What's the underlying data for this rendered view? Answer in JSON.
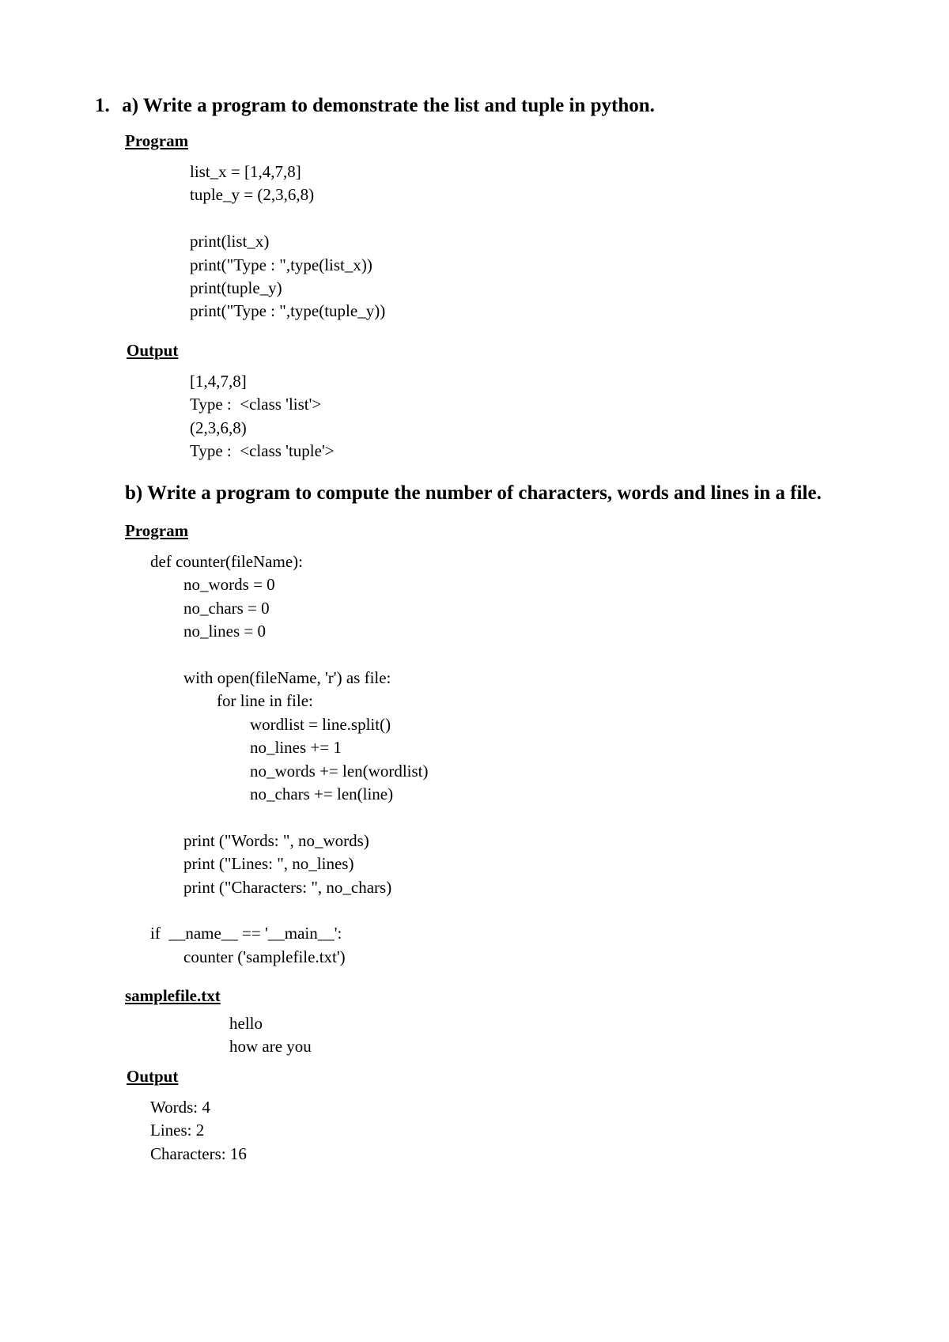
{
  "q1a": {
    "number": "1.",
    "title": "a) Write a program to demonstrate the list and tuple in python.",
    "program_label": "Program",
    "code": "list_x = [1,4,7,8]\ntuple_y = (2,3,6,8)\n\nprint(list_x)\nprint(\"Type : \",type(list_x))\nprint(tuple_y)\nprint(\"Type : \",type(tuple_y))",
    "output_label": "Output",
    "output": "[1,4,7,8]\nType :  <class 'list'>\n(2,3,6,8)\nType :  <class 'tuple'>"
  },
  "q1b": {
    "title": "b) Write a program to compute the number of characters, words and lines in a file.",
    "program_label": "Program",
    "code": "def counter(fileName):\n        no_words = 0\n        no_chars = 0\n        no_lines = 0\n\n        with open(fileName, 'r') as file:\n                for line in file:\n                        wordlist = line.split()\n                        no_lines += 1\n                        no_words += len(wordlist)\n                        no_chars += len(line)\n\n        print (\"Words: \", no_words)\n        print (\"Lines: \", no_lines)\n        print (\"Characters: \", no_chars)\n\nif  __name__ == '__main__':\n        counter ('samplefile.txt')",
    "samplefile_label": "samplefile.txt",
    "samplefile": "hello\nhow are you",
    "output_label": "Output",
    "output": "Words: 4\nLines: 2\nCharacters: 16"
  }
}
